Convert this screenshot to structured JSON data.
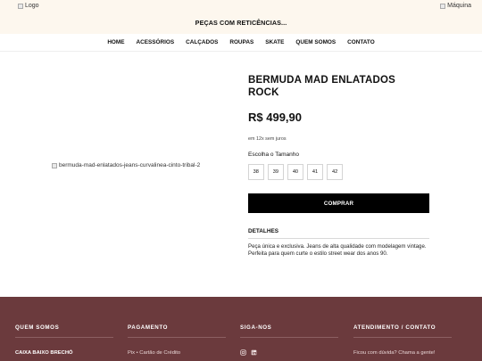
{
  "header": {
    "logo_alt": "Logo",
    "machine_alt": "Máquina",
    "tagline": "PEÇAS COM RETICÊNCIAS..."
  },
  "nav": {
    "items": [
      {
        "label": "HOME"
      },
      {
        "label": "ACESSÓRIOS"
      },
      {
        "label": "CALÇADOS"
      },
      {
        "label": "ROUPAS"
      },
      {
        "label": "SKATE"
      },
      {
        "label": "QUEM SOMOS"
      },
      {
        "label": "CONTATO"
      }
    ]
  },
  "product": {
    "image_alt": "bermuda-mad-enlatados-jeans-curvalinea-cinto-tribal-2",
    "title": "BERMUDA MAD ENLATADOS ROCK",
    "price": "R$ 499,90",
    "installments": "em 12x sem juros",
    "size_label": "Escolha o Tamanho",
    "sizes": [
      "38",
      "39",
      "40",
      "41",
      "42"
    ],
    "buy_label": "COMPRAR",
    "details_heading": "DETALHES",
    "details_text": "Peça única e exclusiva. Jeans de alta qualidade com modelagem vintage. Perfeita para quem curte o estilo street wear dos anos 90."
  },
  "footer": {
    "colors": {
      "background": "#6b3a3d"
    },
    "columns": [
      {
        "heading": "QUEM SOMOS",
        "item": "CAIXA BAIXO BRECHÓ"
      },
      {
        "heading": "PAGAMENTO",
        "item": "Pix • Cartão de Crédito"
      },
      {
        "heading": "SIGA-NOS",
        "icons": [
          "instagram-icon",
          "linkedin-icon"
        ]
      },
      {
        "heading": "ATENDIMENTO / CONTATO",
        "item": "Ficou com dúvida? Chama a gente!"
      }
    ]
  }
}
